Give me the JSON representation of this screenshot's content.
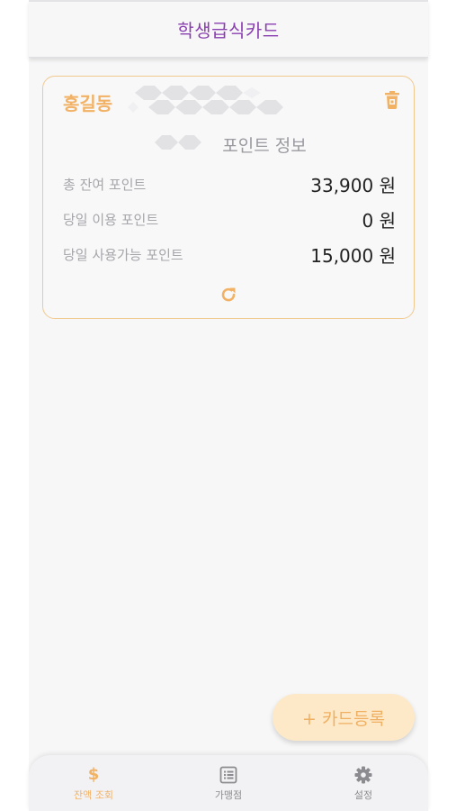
{
  "header": {
    "title": "학생급식카드"
  },
  "card": {
    "holder_name": "홍길동",
    "section_title": "포인트 정보",
    "rows": [
      {
        "label": "총 잔여 포인트",
        "value": "33,900 원"
      },
      {
        "label": "당일 이용 포인트",
        "value": "0 원"
      },
      {
        "label": "당일 사용가능 포인트",
        "value": "15,000 원"
      }
    ],
    "icons": {
      "delete": "trash-icon",
      "refresh": "refresh-icon"
    }
  },
  "fab": {
    "label": "+ 카드등록"
  },
  "bottom_nav": {
    "items": [
      {
        "label": "잔액 조회",
        "icon": "dollar-icon",
        "active": true
      },
      {
        "label": "가맹점",
        "icon": "list-icon",
        "active": false
      },
      {
        "label": "설정",
        "icon": "gear-icon",
        "active": false
      }
    ]
  },
  "colors": {
    "header_title": "#8a3fb0",
    "accent": "#f2b266",
    "card_border": "#f1c98e",
    "fab_bg": "#fde9c8"
  }
}
